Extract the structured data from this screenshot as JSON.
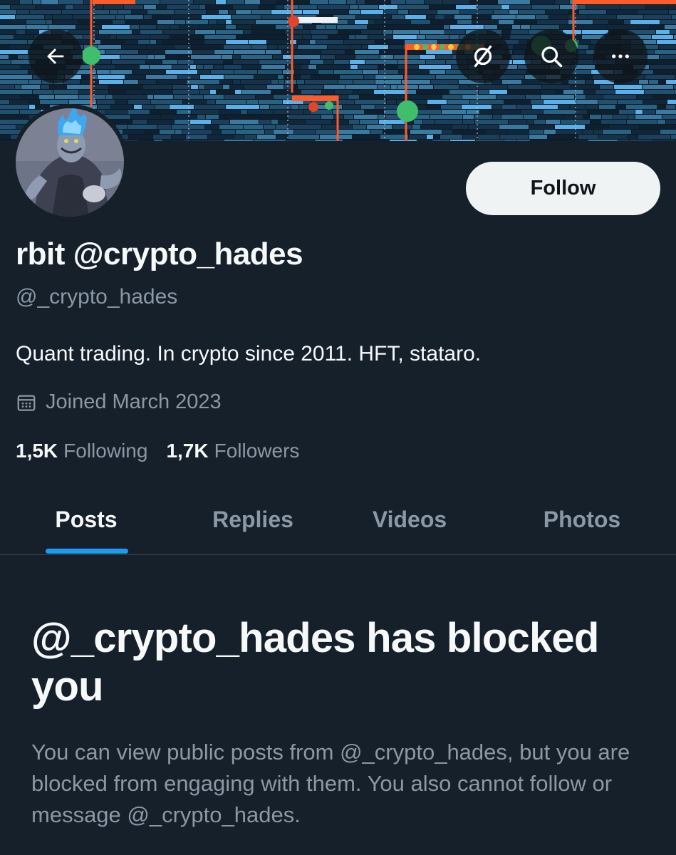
{
  "header": {
    "back_icon": "arrow-left-icon",
    "grok_icon": "slashed-circle-icon",
    "search_icon": "search-icon",
    "more_icon": "more-horizontal-icon"
  },
  "profile": {
    "display_name": "rbit @crypto_hades",
    "handle": "@_crypto_hades",
    "bio": "Quant trading. In crypto since 2011. HFT, stataro.",
    "joined": "Joined March 2023",
    "following_count": "1,5K",
    "following_label": "Following",
    "followers_count": "1,7K",
    "followers_label": "Followers",
    "follow_label": "Follow"
  },
  "tabs": [
    {
      "label": "Posts",
      "active": true
    },
    {
      "label": "Replies",
      "active": false
    },
    {
      "label": "Videos",
      "active": false
    },
    {
      "label": "Photos",
      "active": false
    }
  ],
  "blocked": {
    "title": "@_crypto_hades has blocked you",
    "description": "You can view public posts from @_crypto_hades, but you are blocked from engaging with them. You also cannot follow or message @_crypto_hades."
  },
  "colors": {
    "background": "#15202b",
    "accent": "#1d9bf0",
    "text_primary": "#f7f9f9",
    "text_secondary": "#8b98a5",
    "follow_button_bg": "#eff3f4"
  }
}
